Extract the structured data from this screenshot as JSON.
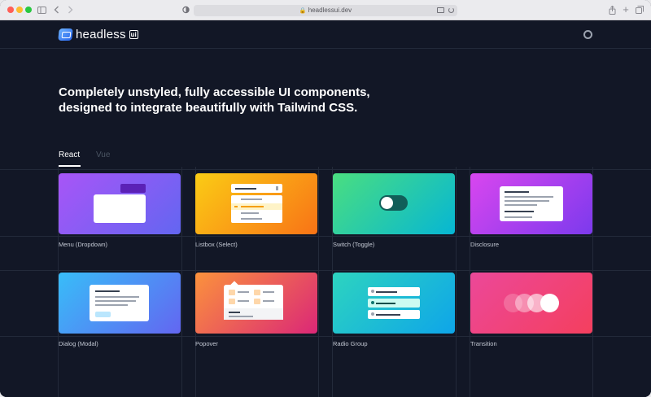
{
  "browser": {
    "url": "headlessui.dev"
  },
  "header": {
    "logo_text": "headless",
    "logo_badge": "ui"
  },
  "hero": {
    "headline_line1": "Completely unstyled, fully accessible UI components,",
    "headline_line2": "designed to integrate beautifully with Tailwind CSS."
  },
  "tabs": [
    {
      "label": "React",
      "active": true
    },
    {
      "label": "Vue",
      "active": false
    }
  ],
  "components": [
    {
      "label": "Menu (Dropdown)",
      "gradient": [
        "#a855f7",
        "#6366f1"
      ]
    },
    {
      "label": "Listbox (Select)",
      "gradient": [
        "#facc15",
        "#f97316"
      ]
    },
    {
      "label": "Switch (Toggle)",
      "gradient": [
        "#4ade80",
        "#06b6d4"
      ]
    },
    {
      "label": "Disclosure",
      "gradient": [
        "#d946ef",
        "#7c3aed"
      ]
    },
    {
      "label": "Dialog (Modal)",
      "gradient": [
        "#38bdf8",
        "#6366f1"
      ]
    },
    {
      "label": "Popover",
      "gradient": [
        "#fb923c",
        "#db2777"
      ]
    },
    {
      "label": "Radio Group",
      "gradient": [
        "#2dd4bf",
        "#0ea5e9"
      ]
    },
    {
      "label": "Transition",
      "gradient": [
        "#ec4899",
        "#f43f5e"
      ]
    }
  ]
}
